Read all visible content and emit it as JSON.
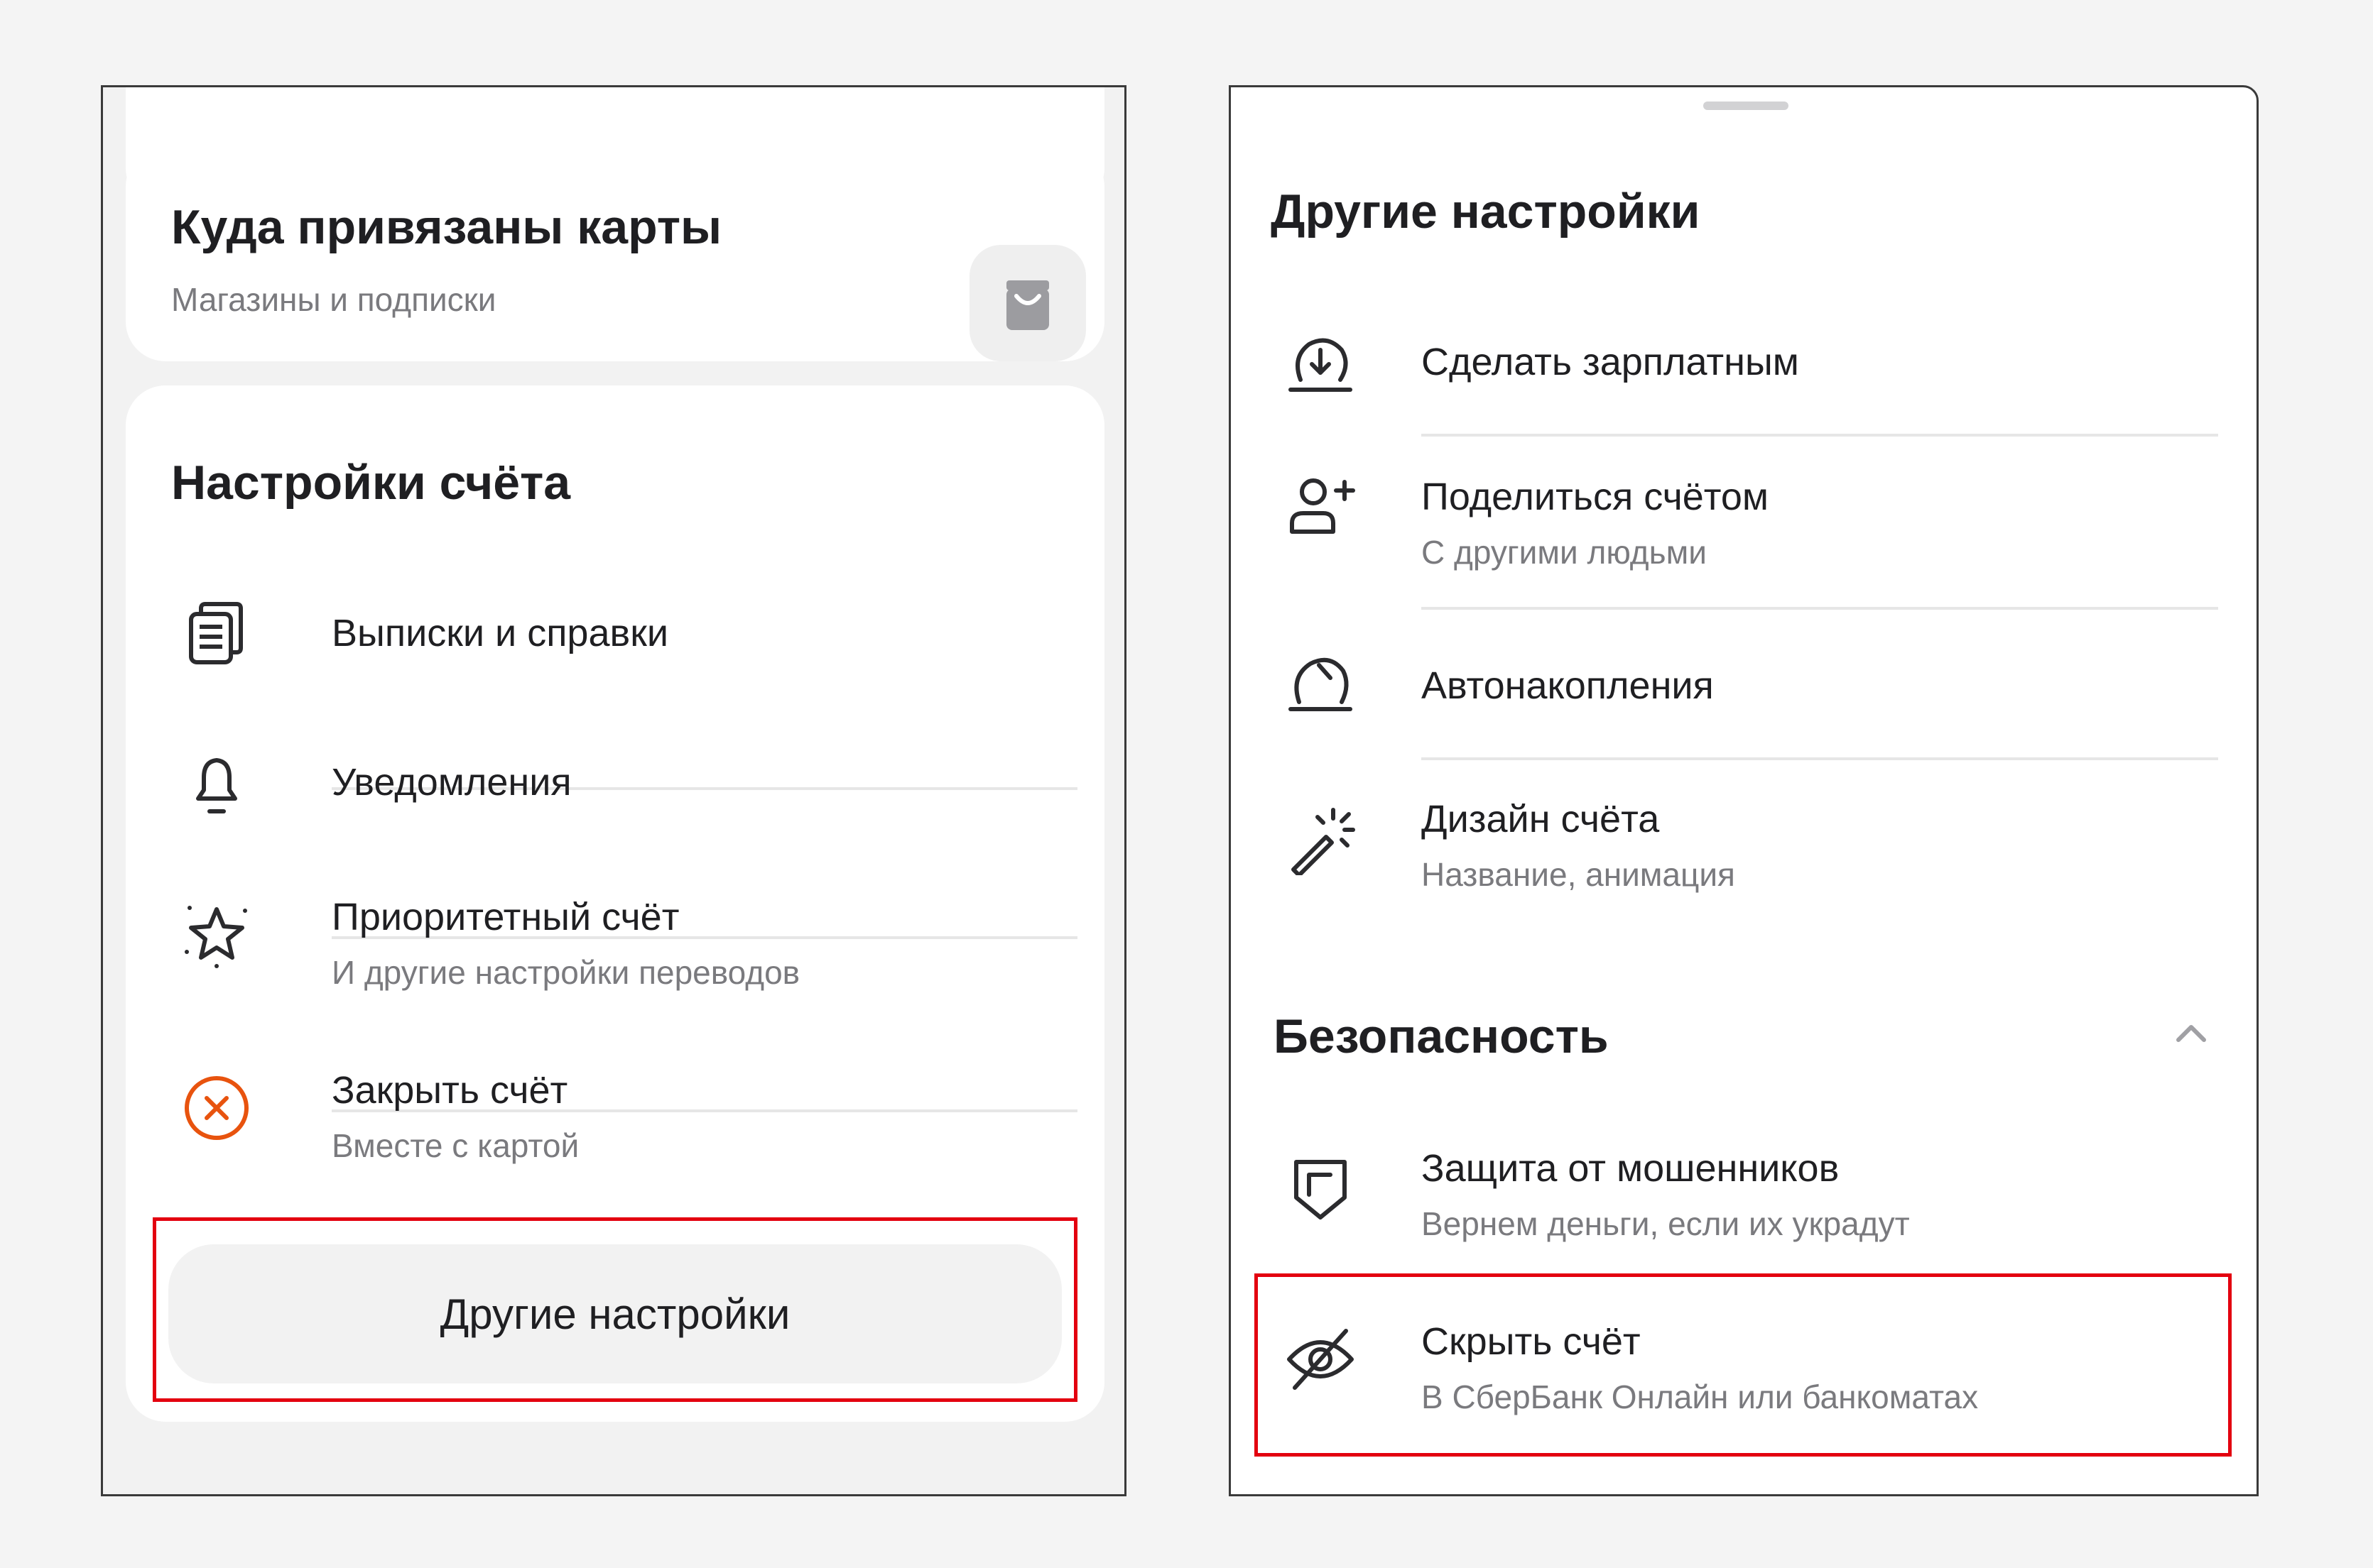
{
  "left_panel": {
    "cards_card": {
      "title": "Куда привязаны карты",
      "subtitle": "Магазины и подписки",
      "icon": "shopping-bag-icon"
    },
    "account_settings": {
      "title": "Настройки счёта",
      "items": [
        {
          "label": "Выписки и справки",
          "sublabel": "",
          "icon": "documents-icon"
        },
        {
          "label": "Уведомления",
          "sublabel": "",
          "icon": "bell-icon"
        },
        {
          "label": "Приоритетный счёт",
          "sublabel": "И другие настройки переводов",
          "icon": "star-icon"
        },
        {
          "label": "Закрыть счёт",
          "sublabel": "Вместе с картой",
          "icon": "close-circle-icon"
        }
      ],
      "other_settings_button": "Другие настройки"
    }
  },
  "right_panel": {
    "title": "Другие настройки",
    "items": [
      {
        "label": "Сделать зарплатным",
        "sublabel": "",
        "icon": "download-circle-icon"
      },
      {
        "label": "Поделиться счётом",
        "sublabel": "С другими людьми",
        "icon": "add-user-icon"
      },
      {
        "label": "Автонакопления",
        "sublabel": "",
        "icon": "gauge-icon"
      },
      {
        "label": "Дизайн счёта",
        "sublabel": "Название, анимация",
        "icon": "magic-wand-icon"
      }
    ],
    "security": {
      "title": "Безопасность",
      "icon": "chevron-up-icon",
      "items": [
        {
          "label": "Защита от мошенников",
          "sublabel": "Вернем деньги, если их украдут",
          "icon": "shield-icon"
        },
        {
          "label": "Скрыть счёт",
          "sublabel": "В СберБанк Онлайн или банкоматах",
          "icon": "eye-crossed-icon"
        }
      ]
    }
  },
  "colors": {
    "highlight_red": "#e3000f",
    "close_orange": "#e8530e",
    "text_primary": "#1f1f22",
    "text_secondary": "#7a7a7e"
  }
}
